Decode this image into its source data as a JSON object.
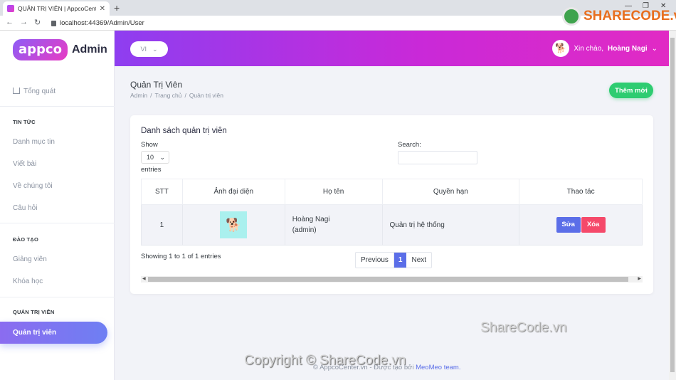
{
  "browser": {
    "tab_title": "QUẢN TRỊ VIÊN | AppcoCenter.vn",
    "url": "localhost:44369/Admin/User"
  },
  "sidebar": {
    "brand_logo": "appco",
    "brand_suffix": "Admin",
    "overview": "Tổng quát",
    "sections": [
      {
        "title": "TIN TỨC",
        "items": [
          "Danh mục tin",
          "Viết bài",
          "Về chúng tôi",
          "Câu hỏi"
        ]
      },
      {
        "title": "ĐÀO TẠO",
        "items": [
          "Giảng viên",
          "Khóa học"
        ]
      },
      {
        "title": "QUẢN TRỊ VIÊN",
        "items": [
          "Quản trị viên"
        ]
      }
    ]
  },
  "header": {
    "language": "VI",
    "greeting": "Xin chào,",
    "user_name": "Hoàng Nagi",
    "accent_start": "#8e3ef0",
    "accent_end": "#e12ac4"
  },
  "page": {
    "title": "Quản Trị Viên",
    "breadcrumb": [
      "Admin",
      "Trang chủ",
      "Quản trị viên"
    ],
    "add_button": "Thêm mới"
  },
  "table_card": {
    "title": "Danh sách quản trị viên",
    "show_label": "Show",
    "length_value": "10",
    "entries_label": "entries",
    "search_label": "Search:",
    "search_value": "",
    "columns": [
      "STT",
      "Ảnh đại diện",
      "Họ tên",
      "Quyền hạn",
      "Thao tác"
    ],
    "rows": [
      {
        "stt": "1",
        "name": "Hoàng Nagi",
        "username": "(admin)",
        "role": "Quản trị hệ thống",
        "edit": "Sửa",
        "delete": "Xóa"
      }
    ],
    "info": "Showing 1 to 1 of 1 entries",
    "pager": {
      "previous": "Previous",
      "current": "1",
      "next": "Next"
    }
  },
  "footer": {
    "copyright": "© AppcoCenter.vn - Được tạo bởi",
    "team": "MeoMeo team."
  },
  "watermarks": {
    "logo": "SHARECODE.vn",
    "middle": "ShareCode.vn",
    "bottom": "Copyright © ShareCode.vn"
  }
}
